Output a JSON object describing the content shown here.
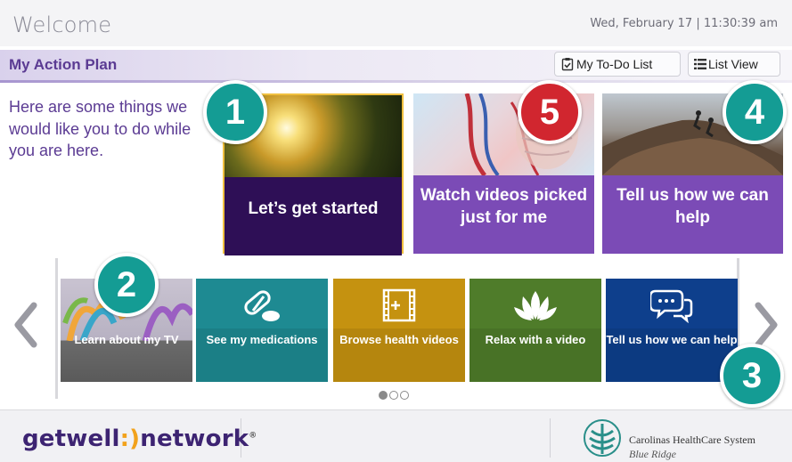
{
  "header": {
    "welcome": "Welcome",
    "datetime": "Wed, February 17 | 11:30:39 am"
  },
  "plan": {
    "title": "My Action Plan",
    "todo_label": "My To-Do List",
    "list_label": "List View"
  },
  "intro": "Here are some things we would like you to do while you are here.",
  "tiles": [
    {
      "label": "Let’s get started"
    },
    {
      "label": "Watch videos picked just for me"
    },
    {
      "label": "Tell us how we can help"
    }
  ],
  "carousel": [
    {
      "label": "Learn about my TV",
      "icon": "tv-people-image"
    },
    {
      "label": "See my medications",
      "icon": "pills-icon"
    },
    {
      "label": "Browse health videos",
      "icon": "film-icon"
    },
    {
      "label": "Relax with a video",
      "icon": "lotus-icon"
    },
    {
      "label": "Tell us how we can help",
      "icon": "chat-bubbles-icon"
    }
  ],
  "pagination": {
    "pages": 3,
    "active": 1
  },
  "badges": [
    "1",
    "2",
    "3",
    "4",
    "5"
  ],
  "footer": {
    "brand_left": "getwell",
    "brand_smile": ":)",
    "brand_right": "network",
    "brand_mark": "®",
    "hospital": "Carolinas HealthCare System",
    "hospital_sub": "Blue Ridge"
  },
  "colors": {
    "purple_dark": "#2e0f56",
    "purple": "#7b4bb6",
    "teal": "#149c94",
    "red": "#d1262f",
    "gold": "#c59210",
    "green": "#4f7c2a",
    "navy": "#0e3f8c"
  }
}
